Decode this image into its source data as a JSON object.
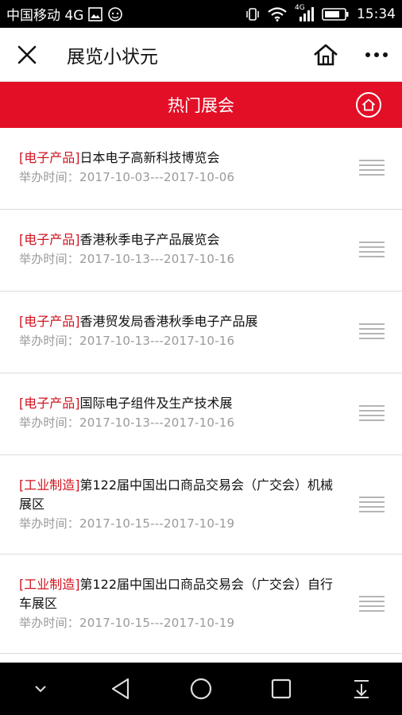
{
  "status_bar": {
    "carrier": "中国移动 4G",
    "network_badge": "4G",
    "time": "15:34"
  },
  "title_bar": {
    "title": "展览小状元"
  },
  "section_header": {
    "title": "热门展会"
  },
  "items": [
    {
      "category": "[电子产品]",
      "name": "日本电子高新科技博览会",
      "time": "举办时间：2017-10-03---2017-10-06"
    },
    {
      "category": "[电子产品]",
      "name": "香港秋季电子产品展览会",
      "time": "举办时间：2017-10-13---2017-10-16"
    },
    {
      "category": "[电子产品]",
      "name": "香港贸发局香港秋季电子产品展",
      "time": "举办时间：2017-10-13---2017-10-16"
    },
    {
      "category": "[电子产品]",
      "name": "国际电子组件及生产技术展",
      "time": "举办时间：2017-10-13---2017-10-16"
    },
    {
      "category": "[工业制造]",
      "name": "第122届中国出口商品交易会（广交会）机械展区",
      "time": "举办时间：2017-10-15---2017-10-19"
    },
    {
      "category": "[工业制造]",
      "name": "第122届中国出口商品交易会（广交会）自行车展区",
      "time": "举办时间：2017-10-15---2017-10-19"
    }
  ]
}
